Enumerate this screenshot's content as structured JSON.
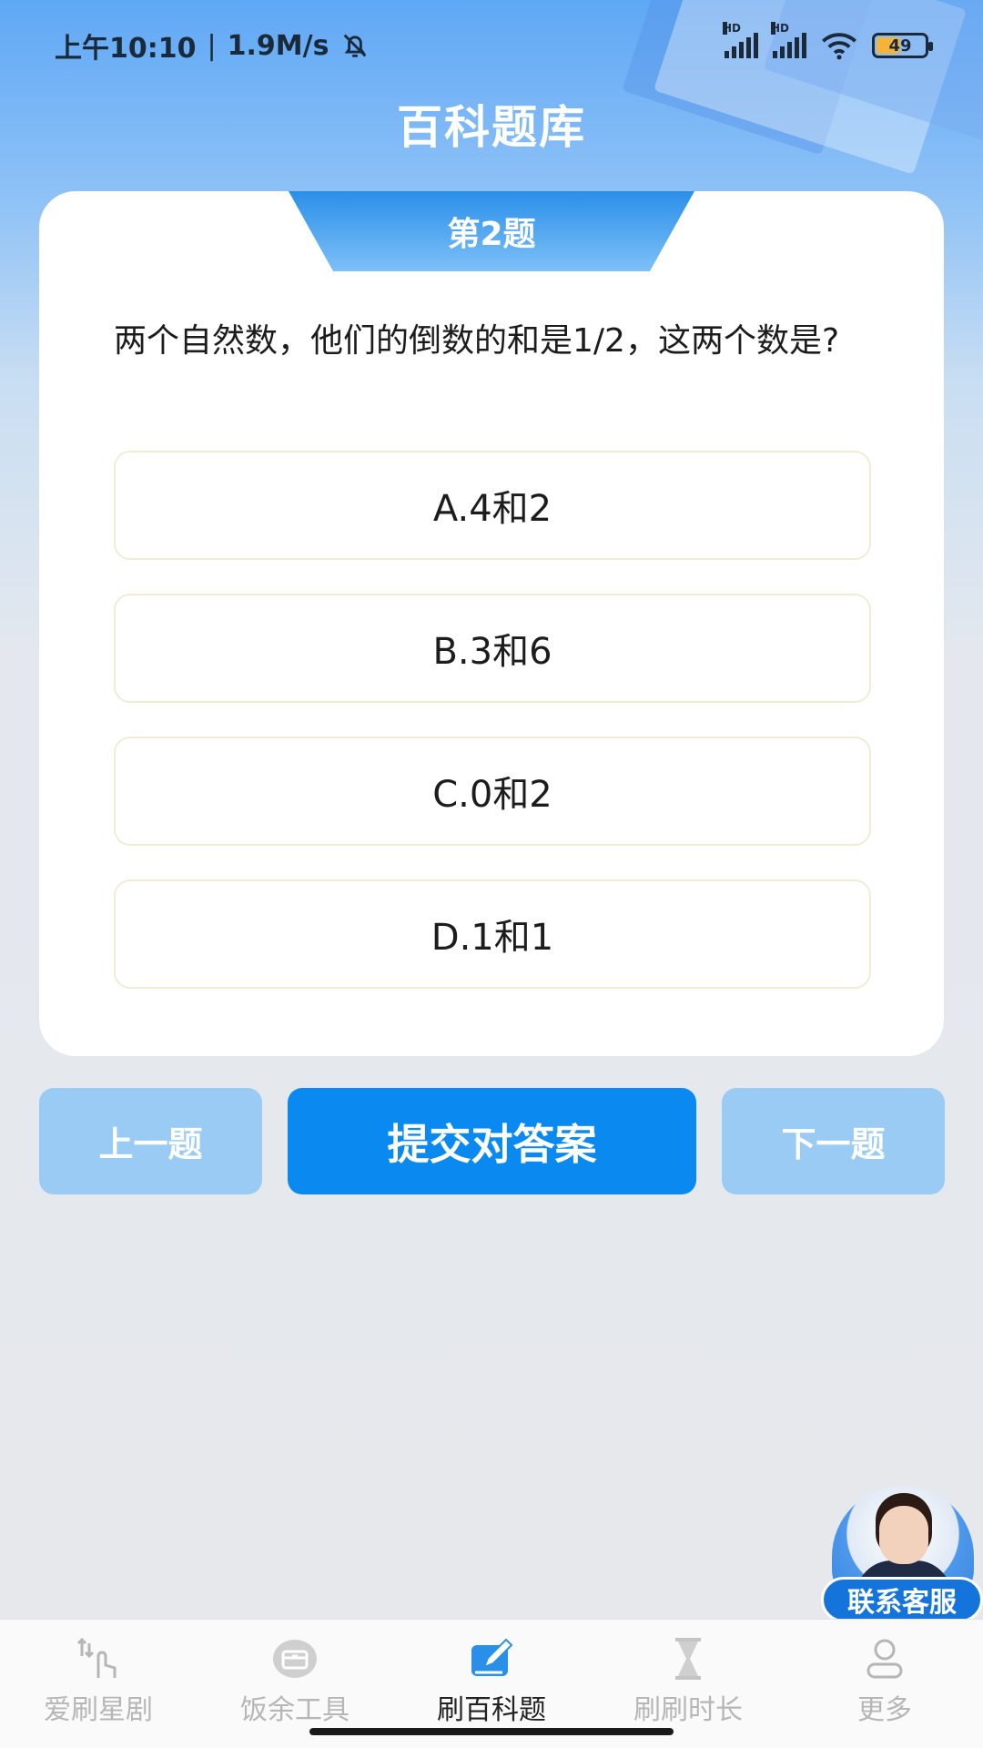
{
  "status_bar": {
    "time": "上午10:10",
    "speed": "1.9M/s",
    "signal_label_1": "HD",
    "signal_label_2": "HD",
    "battery": "49"
  },
  "header": {
    "title": "百科题库"
  },
  "question": {
    "number_label": "第2题",
    "text": "两个自然数，他们的倒数的和是1/2，这两个数是?",
    "options": [
      {
        "label": "A.4和2"
      },
      {
        "label": "B.3和6"
      },
      {
        "label": "C.0和2"
      },
      {
        "label": "D.1和1"
      }
    ]
  },
  "actions": {
    "prev_label": "上一题",
    "submit_label": "提交对答案",
    "next_label": "下一题"
  },
  "contact": {
    "label": "联系客服"
  },
  "bottom_nav": {
    "items": [
      {
        "label": "爱刷星剧",
        "icon": "touch-icon",
        "active": false
      },
      {
        "label": "饭余工具",
        "icon": "toolbox-icon",
        "active": false
      },
      {
        "label": "刷百科题",
        "icon": "edit-icon",
        "active": true
      },
      {
        "label": "刷刷时长",
        "icon": "hourglass-icon",
        "active": false
      },
      {
        "label": "更多",
        "icon": "user-icon",
        "active": false
      }
    ]
  },
  "colors": {
    "primary": "#0a8af0",
    "secondary_button": "#9acbf4",
    "title_text": "#ffffff"
  }
}
